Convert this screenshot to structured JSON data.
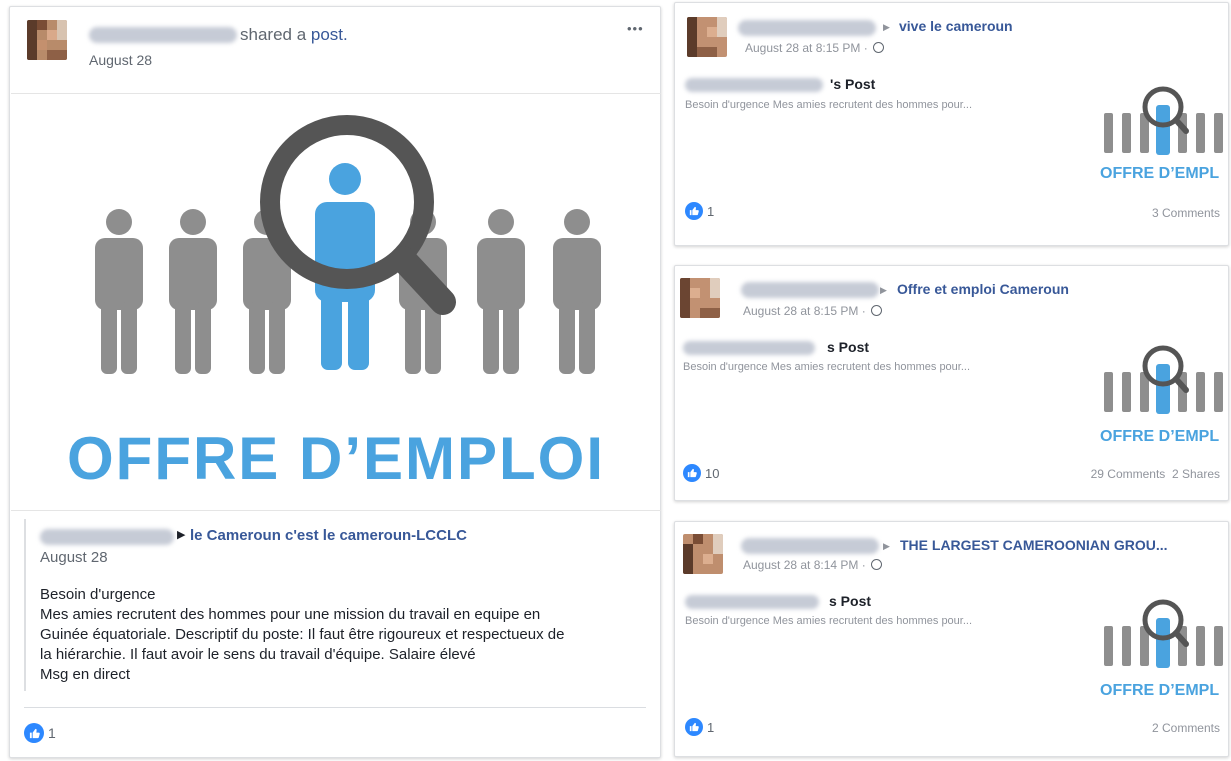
{
  "main_post": {
    "action_text": "shared a ",
    "action_link": "post.",
    "date": "August 28",
    "more_label": "•••",
    "image_text": "OFFRE D’EMPLOI",
    "shared": {
      "group_name": "le Cameroun c'est le cameroun-LCCLC",
      "date": "August 28",
      "body": [
        "Besoin d'urgence",
        "Mes amies recrutent des hommes pour une mission du travail en equipe en",
        "Guinée équatoriale. Descriptif du poste: Il faut être rigoureux et respectueux de",
        "la hiérarchie. Il faut avoir le sens du travail d'équipe. Salaire élevé",
        "Msg en direct"
      ]
    },
    "likes": "1"
  },
  "right_posts": [
    {
      "group": "vive le cameroun",
      "time": "August 28 at 8:15 PM ·",
      "post_title_suffix": "'s Post",
      "excerpt": "Besoin d'urgence Mes amies recrutent des hommes pour...",
      "thumb_text": "OFFRE D’EMPL",
      "likes": "1",
      "stats": "3 Comments"
    },
    {
      "group": "Offre et emploi Cameroun",
      "time": "August 28 at 8:15 PM ·",
      "post_title_suffix": "s Post",
      "excerpt": "Besoin d'urgence Mes amies recrutent des hommes pour...",
      "thumb_text": "OFFRE D’EMPL",
      "likes": "10",
      "stats": "29 Comments  2 Shares"
    },
    {
      "group": "THE LARGEST CAMEROONIAN GROU...",
      "time": "August 28 at 8:14 PM ·",
      "post_title_suffix": "s Post",
      "excerpt": "Besoin d'urgence Mes amies recrutent des hommes pour...",
      "thumb_text": "OFFRE D’EMPL",
      "likes": "1",
      "stats": "2 Comments"
    }
  ],
  "colors": {
    "fb_blue": "#385898",
    "like_blue": "#2d88ff",
    "offer_blue": "#4aa3df",
    "figure_grey": "#8e8e8e",
    "magnifier": "#555555"
  },
  "icons": [
    "more-icon",
    "globe-icon",
    "like-icon",
    "triangle-right-icon",
    "magnifier-icon"
  ]
}
